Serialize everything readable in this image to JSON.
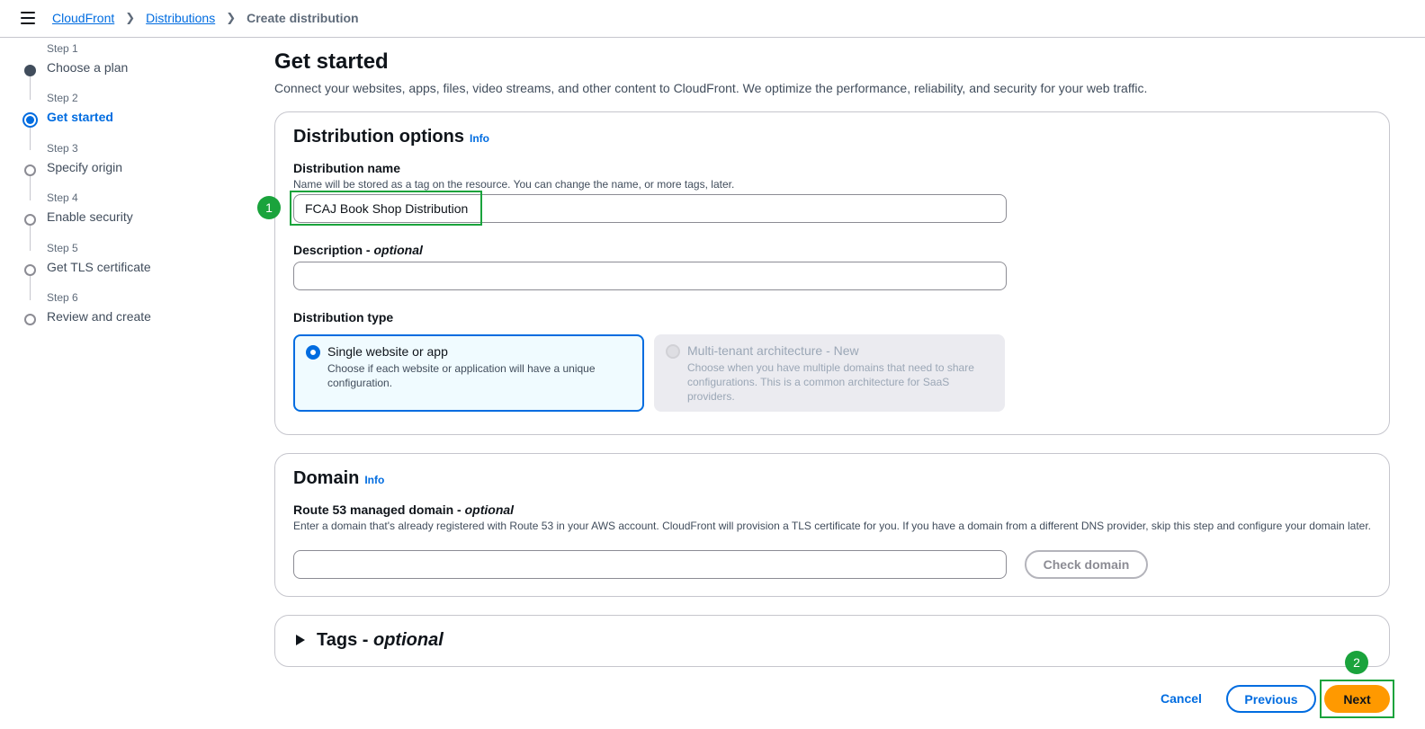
{
  "header": {
    "breadcrumbs": [
      {
        "label": "CloudFront"
      },
      {
        "label": "Distributions"
      },
      {
        "label": "Create distribution"
      }
    ]
  },
  "steps": [
    {
      "number": "Step 1",
      "title": "Choose a plan"
    },
    {
      "number": "Step 2",
      "title": "Get started"
    },
    {
      "number": "Step 3",
      "title": "Specify origin"
    },
    {
      "number": "Step 4",
      "title": "Enable security"
    },
    {
      "number": "Step 5",
      "title": "Get TLS certificate"
    },
    {
      "number": "Step 6",
      "title": "Review and create"
    }
  ],
  "main": {
    "title": "Get started",
    "description": "Connect your websites, apps, files, video streams, and other content to CloudFront. We optimize the performance, reliability, and security for your web traffic."
  },
  "distribution_options": {
    "title": "Distribution options",
    "info": "Info",
    "name_label": "Distribution name",
    "name_hint": "Name will be stored as a tag on the resource. You can change the name, or more tags, later.",
    "name_value": "FCAJ Book Shop Distribution",
    "description_label": "Description",
    "description_suffix": "optional",
    "description_value": "",
    "type_label": "Distribution type",
    "type_options": [
      {
        "title": "Single website or app",
        "description": "Choose if each website or application will have a unique configuration."
      },
      {
        "title": "Multi-tenant architecture - New",
        "description": "Choose when you have multiple domains that need to share configurations. This is a common architecture for SaaS providers."
      }
    ]
  },
  "domain": {
    "title": "Domain",
    "info": "Info",
    "label": "Route 53 managed domain",
    "label_suffix": "optional",
    "hint": "Enter a domain that's already registered with Route 53 in your AWS account. CloudFront will provision a TLS certificate for you. If you have a domain from a different DNS provider, skip this step and configure your domain later.",
    "value": "",
    "check_button": "Check domain"
  },
  "tags": {
    "title": "Tags",
    "suffix": "optional"
  },
  "footer": {
    "cancel": "Cancel",
    "previous": "Previous",
    "next": "Next"
  },
  "annotations": [
    "1",
    "2"
  ],
  "colors": {
    "accent": "#006ce0",
    "primary_button": "#ff9900",
    "annotation": "#1aa33c"
  }
}
